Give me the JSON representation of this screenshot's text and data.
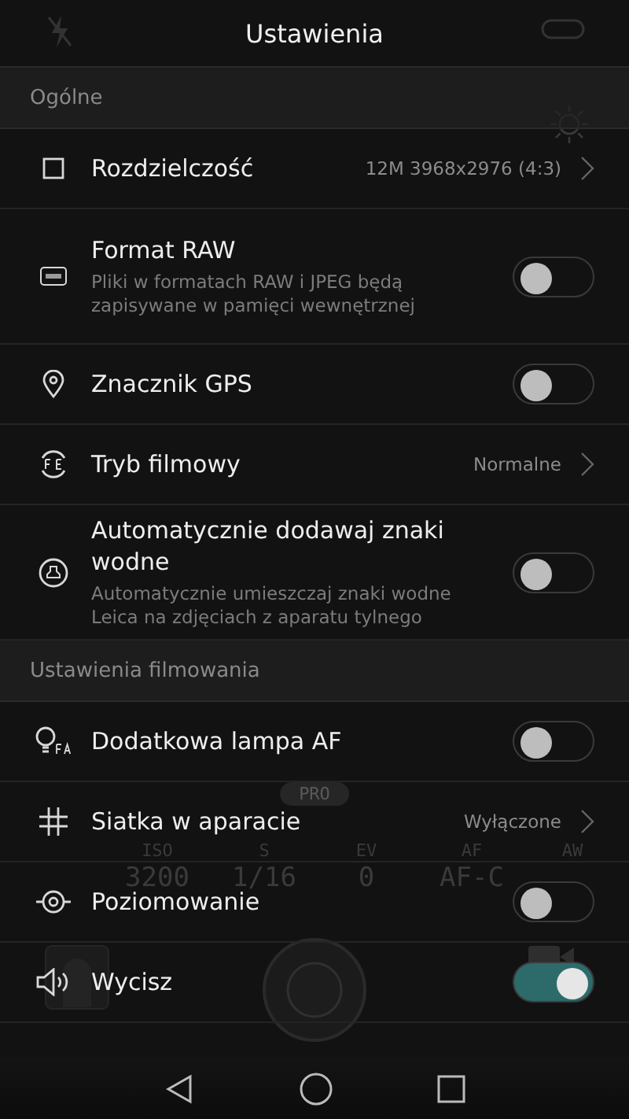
{
  "header": {
    "title": "Ustawienia"
  },
  "camera_view": {
    "mode_badge": "PRO",
    "white_balance": "AW",
    "settings": [
      {
        "label": "ISO",
        "value": "3200"
      },
      {
        "label": "S",
        "value": "1/16"
      },
      {
        "label": "EV",
        "value": "0"
      },
      {
        "label": "AF",
        "value": "AF-C"
      }
    ]
  },
  "sections": [
    {
      "title": "Ogólne",
      "items": [
        {
          "kind": "value",
          "label": "Rozdzielczość",
          "value": "12M 3968x2976 (4:3)"
        },
        {
          "kind": "toggle",
          "label": "Format RAW",
          "description": "Pliki w formatach RAW i JPEG będą zapisywane w pamięci wewnętrznej",
          "on": false
        },
        {
          "kind": "toggle",
          "label": "Znacznik GPS",
          "on": false
        },
        {
          "kind": "value",
          "label": "Tryb filmowy",
          "value": "Normalne"
        },
        {
          "kind": "toggle",
          "label": "Automatycznie dodawaj znaki wodne",
          "description": "Automatycznie umieszczaj znaki wodne Leica na zdjęciach z aparatu tylnego",
          "on": false
        }
      ]
    },
    {
      "title": "Ustawienia filmowania",
      "items": [
        {
          "kind": "toggle",
          "label": "Dodatkowa lampa AF",
          "on": false
        },
        {
          "kind": "value",
          "label": "Siatka w aparacie",
          "value": "Wyłączone"
        },
        {
          "kind": "toggle",
          "label": "Poziomowanie",
          "on": false
        },
        {
          "kind": "toggle",
          "label": "Wycisz",
          "on": true
        }
      ]
    }
  ]
}
